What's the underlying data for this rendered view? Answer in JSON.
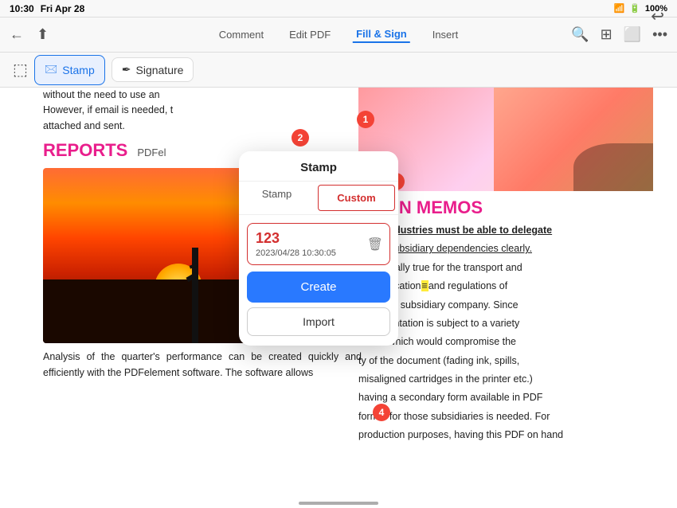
{
  "statusBar": {
    "time": "10:30",
    "day": "Fri Apr 28",
    "wifi": "wifi",
    "battery": "100%"
  },
  "toolbar": {
    "back": "←",
    "share": "share",
    "tabs": [
      {
        "id": "comment",
        "label": "Comment",
        "active": false
      },
      {
        "id": "edit-pdf",
        "label": "Edit PDF",
        "active": false
      },
      {
        "id": "fill-sign",
        "label": "Fill & Sign",
        "active": true
      },
      {
        "id": "insert",
        "label": "Insert",
        "active": false
      }
    ],
    "icons": [
      "search",
      "grid",
      "monitor",
      "more"
    ],
    "undo": "↩"
  },
  "secondaryToolbar": {
    "buttons": [
      {
        "id": "stamp",
        "label": "Stamp",
        "selected": true,
        "icon": "🖂"
      },
      {
        "id": "signature",
        "label": "Signature",
        "selected": false,
        "icon": "✒"
      }
    ]
  },
  "stampPopup": {
    "title": "Stamp",
    "tabs": [
      {
        "id": "stamp",
        "label": "Stamp",
        "active": false
      },
      {
        "id": "custom",
        "label": "Custom",
        "active": true
      }
    ],
    "items": [
      {
        "number": "123",
        "date": "2023/04/28 10:30:05"
      }
    ],
    "createButton": "Create",
    "importButton": "Import"
  },
  "pdf": {
    "leftText1": "without the need to use an",
    "leftText2": "However, if email is needed, t",
    "leftText3": "attached and sent.",
    "reportsHeading": "REPORTS",
    "pdfLabel": "PDFel",
    "analysisText": "Analysis of the quarter's performance can be created quickly and efficiently with the PDFelement software. The software allows",
    "navigationHeading": "ATION MEMOS",
    "rightLines": [
      "I Gas industries must be able to delegate",
      "o their subsidiary dependencies clearly.",
      "s especially true for the transport and",
      "y specification",
      "and regulations of",
      "ort to the subsidiary company. Since",
      "documentation is subject to a variety",
      "ments which would compromise the",
      "ty of the document (fading ink, spills,",
      "misaligned cartridges in the printer etc.)",
      "having a secondary form available in PDF",
      "format for those subsidiaries is needed. For",
      "production purposes, having this PDF on hand"
    ]
  },
  "badges": [
    {
      "id": 1,
      "label": "1"
    },
    {
      "id": 2,
      "label": "2"
    },
    {
      "id": 3,
      "label": "3"
    },
    {
      "id": 4,
      "label": "4"
    }
  ]
}
